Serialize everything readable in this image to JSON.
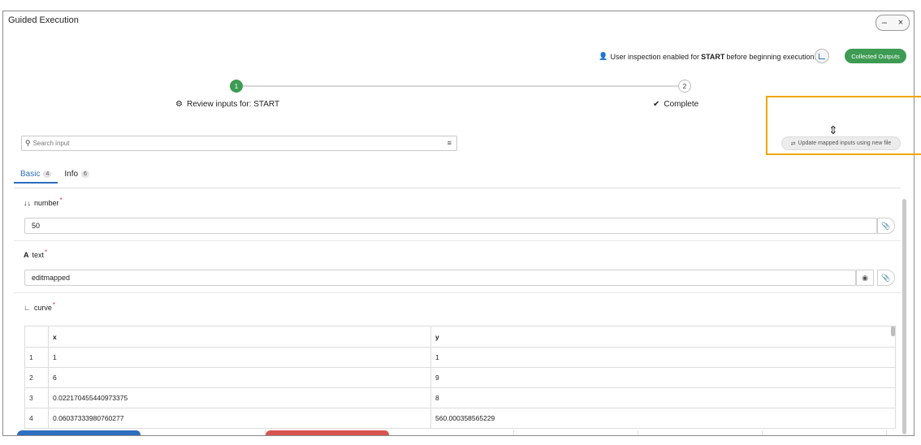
{
  "window": {
    "title": "Guided Execution",
    "minimize": "–",
    "close": "×"
  },
  "header": {
    "inspection_prefix": "User inspection enabled for",
    "inspection_bold": "START",
    "inspection_suffix": "before beginning execution.",
    "collected_outputs": "Collected Outputs"
  },
  "stepper": {
    "steps": [
      {
        "number": "1",
        "label": "Review inputs for: START",
        "state": "active"
      },
      {
        "number": "2",
        "label": "Complete",
        "state": "pending"
      }
    ]
  },
  "search": {
    "placeholder": "Search input"
  },
  "update_button": "Update mapped inputs using new file",
  "tabs": [
    {
      "label": "Basic",
      "count": "4"
    },
    {
      "label": "Info",
      "count": "6"
    }
  ],
  "fields": {
    "number": {
      "label": "number",
      "value": "50"
    },
    "text": {
      "label": "text",
      "value": "editmapped"
    },
    "curve": {
      "label": "curve",
      "columns": [
        "x",
        "y"
      ],
      "rows": [
        {
          "idx": "1",
          "x": "1",
          "y": "1"
        },
        {
          "idx": "2",
          "x": "6",
          "y": "9"
        },
        {
          "idx": "3",
          "x": "0.022170455440973375",
          "y": "8"
        },
        {
          "idx": "4",
          "x": "0.06037333980760277",
          "y": "560.000358565229"
        }
      ]
    }
  },
  "colors": {
    "accent": "#2b6fc0",
    "success": "#3d9b53",
    "highlight": "#f0a400",
    "required": "#dd3333"
  }
}
